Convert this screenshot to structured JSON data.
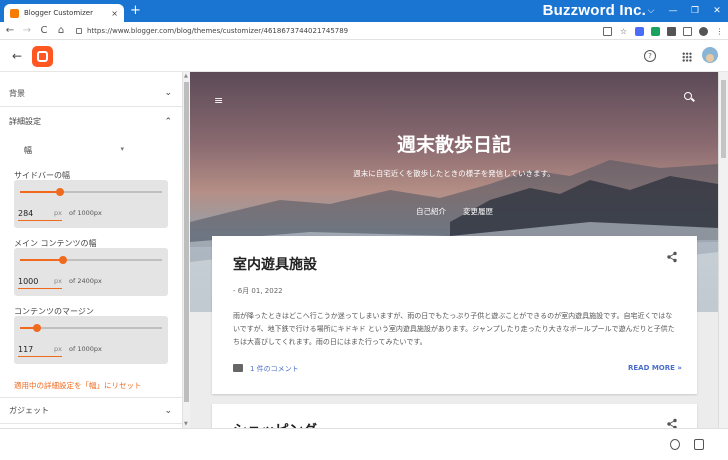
{
  "browser": {
    "tab_title": "Blogger Customizer",
    "tab_close": "×",
    "new_tab": "+",
    "brand_overlay": "Buzzword Inc.",
    "window_controls": [
      "⌵",
      "—",
      "❐",
      "✕"
    ],
    "url": "https://www.blogger.com/blog/themes/customizer/4618673744021745789",
    "nav": {
      "back": "←",
      "forward": "→",
      "reload": "C",
      "home": "⌂"
    },
    "toolbar_icons": [
      "share-icon",
      "star-icon",
      "extension-icon",
      "sync-icon",
      "puzzle-icon",
      "sidepanel-icon",
      "profile-icon",
      "menu-icon"
    ]
  },
  "app_header": {
    "back": "←",
    "help": "?",
    "accent": "#ff5722"
  },
  "panel": {
    "sections": {
      "background": "背景",
      "advanced": "詳細設定",
      "gadget": "ガジェット"
    },
    "select_value": "幅",
    "select_caret": "▾",
    "chevron_down": "⌄",
    "chevron_up": "⌃",
    "sliders": [
      {
        "label": "サイドバーの幅",
        "value": "284",
        "unit": "px",
        "range": "of 1000px",
        "fraction": 0.284
      },
      {
        "label": "メイン コンテンツの幅",
        "value": "1000",
        "unit": "px",
        "range": "of 2400px",
        "fraction": 0.3
      },
      {
        "label": "コンテンツのマージン",
        "value": "117",
        "unit": "px",
        "range": "of 1000px",
        "fraction": 0.117
      }
    ],
    "reset_link": "適用中の詳細設定を「幅」にリセット",
    "accent": "#f06a1e"
  },
  "preview": {
    "menu_icon": "≡",
    "blog_title": "週末散歩日記",
    "blog_description": "週末に自宅近くを散歩したときの様子を発信していきます。",
    "nav_links": [
      "自己紹介",
      "変更履歴"
    ],
    "posts": [
      {
        "title": "室内遊具施設",
        "date": "- 6月 01, 2022",
        "body": "雨が降ったときはどこへ行こうか迷ってしまいますが、雨の日でもたっぷり子供と遊ぶことができるのが室内遊具施設です。自宅近くではないですが、地下鉄で行ける場所にキドキド という室内遊具施設があります。ジャンプしたり走ったり大きなボールプールで遊んだりと子供たちは大喜びしてくれます。雨の日にはまた行ってみたいです。",
        "comments": "1 件のコメント",
        "read_more": "READ MORE »"
      },
      {
        "title": "ショッピング"
      }
    ]
  }
}
